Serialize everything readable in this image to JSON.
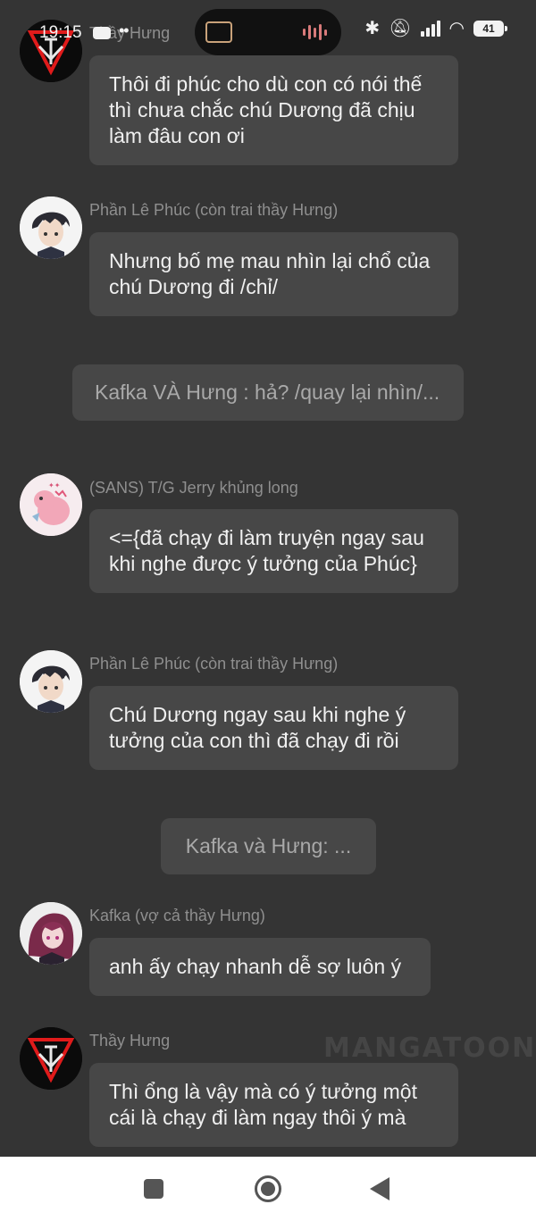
{
  "status_bar": {
    "time": "19:15",
    "more": "••",
    "battery": "41"
  },
  "messages": [
    {
      "sender": "Thầy Hưng",
      "text": "Thôi đi phúc cho dù con có nói thế thì chưa chắc chú Dương đã chịu làm đâu con ơi"
    },
    {
      "sender": "Phần Lê Phúc (còn trai thầy Hưng)",
      "text": "Nhưng bố mẹ mau nhìn lại chổ của chú Dương đi /chỉ/"
    },
    {
      "narration": "Kafka VÀ Hưng : hả? /quay lại nhìn/..."
    },
    {
      "sender": "(SANS) T/G Jerry khủng long",
      "text": "<={đã chạy đi làm truyện ngay sau khi nghe được ý tưởng của Phúc}"
    },
    {
      "sender": "Phần Lê Phúc (còn trai thầy Hưng)",
      "text": "Chú Dương ngay sau khi nghe ý tưởng của con thì đã chạy đi rồi"
    },
    {
      "narration": "Kafka và Hưng: ..."
    },
    {
      "sender": "Kafka (vợ cả thầy Hưng)",
      "text": "anh ấy chạy nhanh dễ sợ luôn ý"
    },
    {
      "sender": "Thầy Hưng",
      "text": "Thì ổng là vậy mà có ý tưởng một cái là chạy đi làm ngay thôi ý mà"
    }
  ],
  "watermark": "MANGATOON",
  "colors": {
    "background": "#343434",
    "bubble": "#474747",
    "sender_text": "#8f8f8f",
    "message_text": "#f0f0f0",
    "narration_text": "#a9a9a9"
  }
}
